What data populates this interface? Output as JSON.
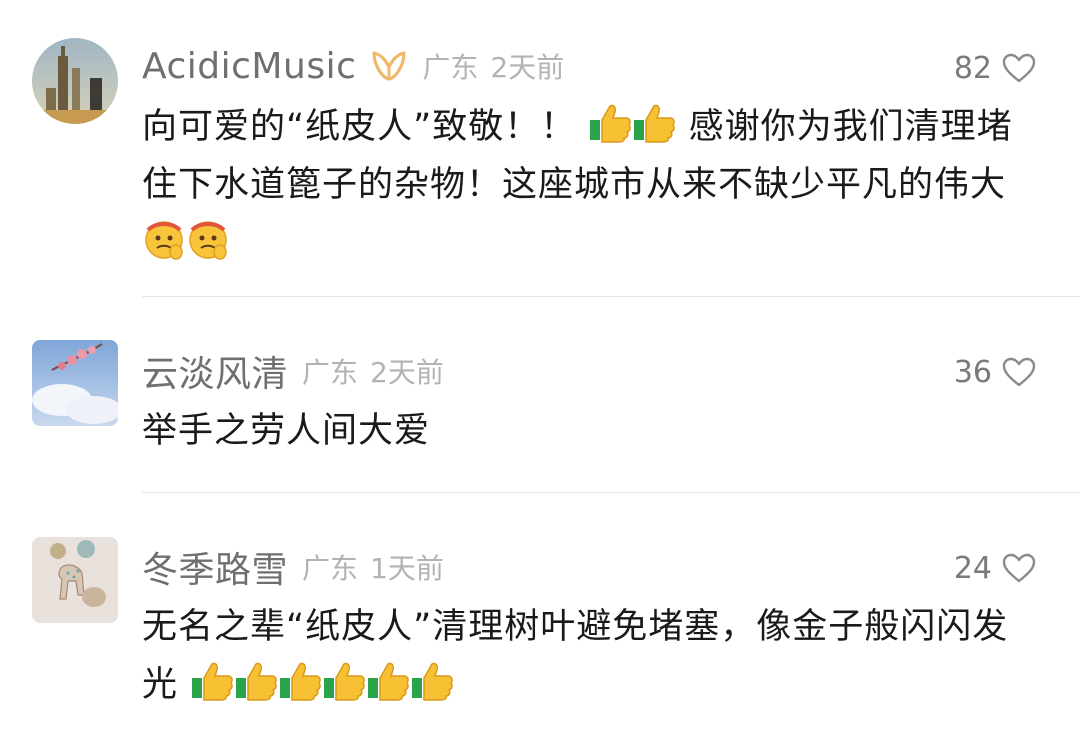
{
  "comments": [
    {
      "username": "AcidicMusic",
      "location": "广东",
      "time": "2天前",
      "likes": "82",
      "text_a": "向可爱的“纸皮人”致敬！！",
      "text_b": "感谢你为我们清理堵住下水道篦子的杂物！这座城市从来不缺少平凡的伟大",
      "emojis_mid": [
        "thumbs-up",
        "thumbs-up"
      ],
      "emojis_end": [
        "salute-face",
        "salute-face"
      ]
    },
    {
      "username": "云淡风清",
      "location": "广东",
      "time": "2天前",
      "likes": "36",
      "text_a": "举手之劳人间大爱"
    },
    {
      "username": "冬季路雪",
      "location": "广东",
      "time": "1天前",
      "likes": "24",
      "text_a": "无名之辈“纸皮人”清理树叶避免堵塞，像金子般闪闪发光",
      "emojis_end": [
        "thumbs-up",
        "thumbs-up",
        "thumbs-up",
        "thumbs-up",
        "thumbs-up",
        "thumbs-up"
      ]
    }
  ],
  "colors": {
    "username": "#6f6f6f",
    "meta": "#b3b3b3",
    "text": "#1a1a1a",
    "badge": "#f0b86a"
  }
}
